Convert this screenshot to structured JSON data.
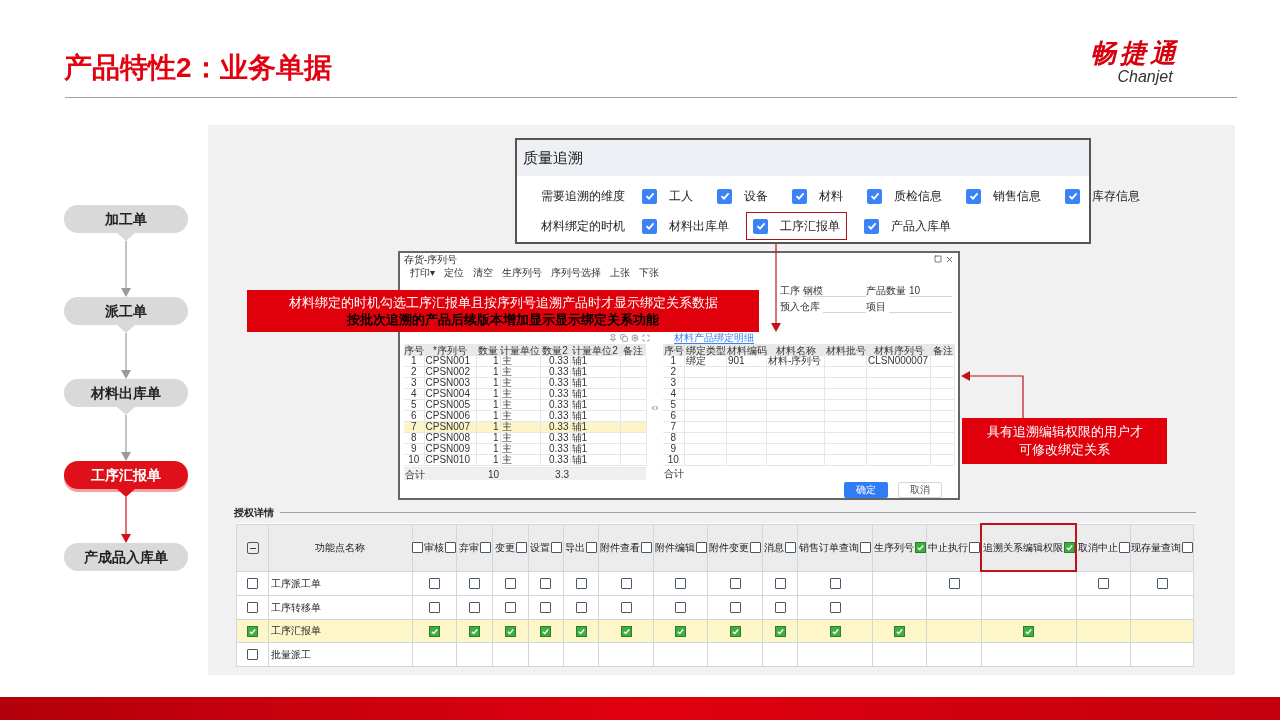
{
  "title": "产品特性2：业务单据",
  "logo": {
    "mark": "畅捷通",
    "wordmark": "Chanjet"
  },
  "flow": [
    {
      "label": "加工单",
      "selected": false
    },
    {
      "label": "派工单",
      "selected": false
    },
    {
      "label": "材料出库单",
      "selected": false
    },
    {
      "label": "工序汇报单",
      "selected": true
    },
    {
      "label": "产成品入库单",
      "selected": false
    }
  ],
  "quality_panel": {
    "title": "质量追溯",
    "rows": [
      {
        "label": "需要追溯的维度",
        "options": [
          {
            "label": "工人",
            "checked": true,
            "highlighted": false
          },
          {
            "label": "设备",
            "checked": true,
            "highlighted": false
          },
          {
            "label": "材料",
            "checked": true,
            "highlighted": false
          },
          {
            "label": "质检信息",
            "checked": true,
            "highlighted": false
          },
          {
            "label": "销售信息",
            "checked": true,
            "highlighted": false
          },
          {
            "label": "库存信息",
            "checked": true,
            "highlighted": false
          }
        ]
      },
      {
        "label": "材料绑定的时机",
        "options": [
          {
            "label": "材料出库单",
            "checked": true,
            "highlighted": false
          },
          {
            "label": "工序汇报单",
            "checked": true,
            "highlighted": true
          },
          {
            "label": "产品入库单",
            "checked": true,
            "highlighted": false
          }
        ]
      }
    ]
  },
  "dialog": {
    "title": "存货-序列号",
    "toolbar": [
      "打印▾",
      "定位",
      "清空",
      "生序列号",
      "序列号选择",
      "上张",
      "下张"
    ],
    "fields": [
      {
        "label": "工序",
        "value": "钢模"
      },
      {
        "label": "产品数量",
        "value": "10"
      },
      {
        "label": "预入仓库"
      },
      {
        "label": "项目"
      }
    ],
    "tab": "材料产品绑定明细",
    "left_table": {
      "columns": [
        "序号",
        "*序列号",
        "数量",
        "计量单位",
        "数量2",
        "计量单位2",
        "备注"
      ],
      "rows": [
        {
          "cells": [
            "1",
            "CPSN001",
            "1",
            "主",
            "0.33",
            "辅1"
          ],
          "selected": false
        },
        {
          "cells": [
            "2",
            "CPSN002",
            "1",
            "主",
            "0.33",
            "辅1"
          ],
          "selected": false
        },
        {
          "cells": [
            "3",
            "CPSN003",
            "1",
            "主",
            "0.33",
            "辅1"
          ],
          "selected": false
        },
        {
          "cells": [
            "4",
            "CPSN004",
            "1",
            "主",
            "0.33",
            "辅1"
          ],
          "selected": false
        },
        {
          "cells": [
            "5",
            "CPSN005",
            "1",
            "主",
            "0.33",
            "辅1"
          ],
          "selected": false
        },
        {
          "cells": [
            "6",
            "CPSN006",
            "1",
            "主",
            "0.33",
            "辅1"
          ],
          "selected": false
        },
        {
          "cells": [
            "7",
            "CPSN007",
            "1",
            "主",
            "0.33",
            "辅1"
          ],
          "selected": true
        },
        {
          "cells": [
            "8",
            "CPSN008",
            "1",
            "主",
            "0.33",
            "辅1"
          ],
          "selected": false
        },
        {
          "cells": [
            "9",
            "CPSN009",
            "1",
            "主",
            "0.33",
            "辅1"
          ],
          "selected": false
        },
        {
          "cells": [
            "10",
            "CPSN010",
            "1",
            "主",
            "0.33",
            "辅1"
          ],
          "selected": false
        }
      ],
      "totals": {
        "label": "合计",
        "qty": "10",
        "qty2": "3.3"
      }
    },
    "right_table": {
      "columns": [
        "序号",
        "绑定类型",
        "材料编码",
        "材料名称",
        "材料批号",
        "材料序列号",
        "备注"
      ],
      "rows": [
        {
          "index": "1",
          "type": "绑定",
          "code": "901",
          "name": "材料-序列号",
          "serial": "CLSN000007"
        },
        {
          "index": "2"
        },
        {
          "index": "3"
        },
        {
          "index": "4"
        },
        {
          "index": "5"
        },
        {
          "index": "6"
        },
        {
          "index": "7"
        },
        {
          "index": "8"
        },
        {
          "index": "9"
        },
        {
          "index": "10"
        }
      ],
      "totals": {
        "label": "合计"
      }
    },
    "buttons": [
      {
        "label": "确定",
        "kind": "primary"
      },
      {
        "label": "取消",
        "kind": "secondary"
      }
    ]
  },
  "callout_binding": {
    "lines": [
      "材料绑定的时机勾选工序汇报单且按序列号追溯产品时才显示绑定关系数据",
      "按批次追溯的产品后续版本增加显示显示绑定关系功能"
    ]
  },
  "callout_permission": {
    "lines": [
      "具有追溯编辑权限的用户才",
      "可修改绑定关系"
    ]
  },
  "permissions": {
    "title": "授权详情",
    "header_indeterminate": true,
    "name_column": "功能点名称",
    "lead_checked": false,
    "columns": [
      {
        "label": "审核",
        "checked": false,
        "highlighted": false
      },
      {
        "label": "弃审",
        "checked": false,
        "highlighted": false
      },
      {
        "label": "变更",
        "checked": false,
        "highlighted": false
      },
      {
        "label": "设置",
        "checked": false,
        "highlighted": false
      },
      {
        "label": "导出",
        "checked": false,
        "highlighted": false
      },
      {
        "label": "附件查看",
        "checked": false,
        "highlighted": false
      },
      {
        "label": "附件编辑",
        "checked": false,
        "highlighted": false
      },
      {
        "label": "附件变更",
        "checked": false,
        "highlighted": false
      },
      {
        "label": "消息",
        "checked": false,
        "highlighted": false
      },
      {
        "label": "销售订单查询",
        "checked": false,
        "highlighted": false
      },
      {
        "label": "生序列号",
        "checked": true,
        "highlighted": false
      },
      {
        "label": "中止执行",
        "checked": false,
        "highlighted": false
      },
      {
        "label": "追溯关系编辑权限",
        "checked": true,
        "highlighted": true
      },
      {
        "label": "取消中止",
        "checked": false,
        "highlighted": false
      },
      {
        "label": "现存量查询",
        "checked": false,
        "highlighted": false
      }
    ],
    "rows": [
      {
        "name": "工序派工单",
        "checked": false,
        "cells": [
          {
            "kind": "checkbox",
            "checked": false
          },
          {
            "kind": "checkbox",
            "checked": false
          },
          {
            "kind": "checkbox",
            "checked": false
          },
          {
            "kind": "checkbox",
            "checked": false
          },
          {
            "kind": "checkbox",
            "checked": false
          },
          {
            "kind": "checkbox",
            "checked": false
          },
          {
            "kind": "checkbox",
            "checked": false
          },
          {
            "kind": "checkbox",
            "checked": false
          },
          {
            "kind": "checkbox",
            "checked": false
          },
          {
            "kind": "checkbox",
            "checked": false
          },
          {
            "kind": "empty"
          },
          {
            "kind": "checkbox",
            "checked": false
          },
          {
            "kind": "empty"
          },
          {
            "kind": "checkbox",
            "checked": false
          },
          {
            "kind": "checkbox",
            "checked": false
          }
        ]
      },
      {
        "name": "工序转移单",
        "checked": false,
        "cells": [
          {
            "kind": "checkbox",
            "checked": false
          },
          {
            "kind": "checkbox",
            "checked": false
          },
          {
            "kind": "checkbox",
            "checked": false
          },
          {
            "kind": "checkbox",
            "checked": false
          },
          {
            "kind": "checkbox",
            "checked": false
          },
          {
            "kind": "checkbox",
            "checked": false
          },
          {
            "kind": "checkbox",
            "checked": false
          },
          {
            "kind": "checkbox",
            "checked": false
          },
          {
            "kind": "checkbox",
            "checked": false
          },
          {
            "kind": "checkbox",
            "checked": false
          },
          {
            "kind": "empty"
          },
          {
            "kind": "empty"
          },
          {
            "kind": "empty"
          },
          {
            "kind": "empty"
          },
          {
            "kind": "empty"
          }
        ]
      },
      {
        "name": "工序汇报单",
        "checked": true,
        "cells": [
          {
            "kind": "checkbox",
            "checked": true
          },
          {
            "kind": "checkbox",
            "checked": true
          },
          {
            "kind": "checkbox",
            "checked": true
          },
          {
            "kind": "checkbox",
            "checked": true
          },
          {
            "kind": "checkbox",
            "checked": true
          },
          {
            "kind": "checkbox",
            "checked": true
          },
          {
            "kind": "checkbox",
            "checked": true
          },
          {
            "kind": "checkbox",
            "checked": true
          },
          {
            "kind": "checkbox",
            "checked": true
          },
          {
            "kind": "checkbox",
            "checked": true
          },
          {
            "kind": "checkbox",
            "checked": true
          },
          {
            "kind": "empty"
          },
          {
            "kind": "checkbox",
            "checked": true
          },
          {
            "kind": "empty"
          },
          {
            "kind": "empty"
          }
        ]
      },
      {
        "name": "批量派工",
        "checked": false,
        "cells": [
          {
            "kind": "empty"
          },
          {
            "kind": "empty"
          },
          {
            "kind": "empty"
          },
          {
            "kind": "empty"
          },
          {
            "kind": "empty"
          },
          {
            "kind": "empty"
          },
          {
            "kind": "empty"
          },
          {
            "kind": "empty"
          },
          {
            "kind": "empty"
          },
          {
            "kind": "empty"
          },
          {
            "kind": "empty"
          },
          {
            "kind": "empty"
          },
          {
            "kind": "empty"
          },
          {
            "kind": "empty"
          },
          {
            "kind": "empty"
          }
        ]
      }
    ]
  }
}
